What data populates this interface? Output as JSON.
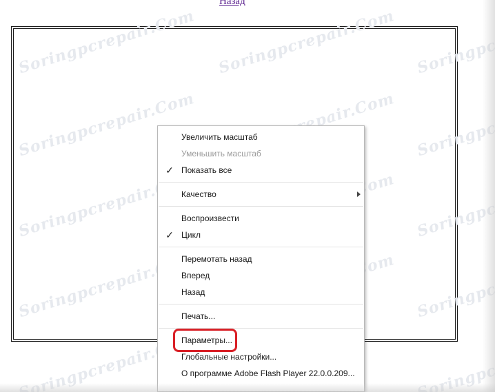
{
  "page": {
    "back_link": "Назад",
    "watermark_text": "Soringpcrepair.Com"
  },
  "colors": {
    "highlight": "#d91f26",
    "disabled_text": "#9a9a9a",
    "link": "#551a8b"
  },
  "context_menu": {
    "groups": [
      [
        {
          "label": "Увеличить масштаб",
          "enabled": true,
          "checked": false
        },
        {
          "label": "Уменьшить масштаб",
          "enabled": false,
          "checked": false
        },
        {
          "label": "Показать все",
          "enabled": true,
          "checked": true,
          "check_icon": "checkmark-icon"
        }
      ],
      [
        {
          "label": "Качество",
          "enabled": true,
          "submenu": true,
          "submenu_icon": "submenu-arrow-icon"
        }
      ],
      [
        {
          "label": "Воспроизвести",
          "enabled": true,
          "checked": false
        },
        {
          "label": "Цикл",
          "enabled": true,
          "checked": true,
          "check_icon": "checkmark-icon"
        }
      ],
      [
        {
          "label": "Перемотать назад",
          "enabled": true
        },
        {
          "label": "Вперед",
          "enabled": true
        },
        {
          "label": "Назад",
          "enabled": true
        }
      ],
      [
        {
          "label": "Печать...",
          "enabled": true
        }
      ],
      [
        {
          "label": "Параметры...",
          "enabled": true,
          "highlighted": true
        },
        {
          "label": "Глобальные настройки...",
          "enabled": true
        },
        {
          "label": "О программе Adobe Flash Player 22.0.0.209...",
          "enabled": true
        }
      ]
    ]
  }
}
